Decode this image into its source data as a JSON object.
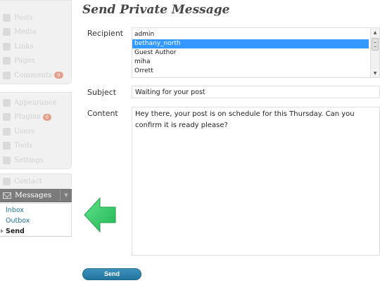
{
  "sidebar": {
    "block1": [
      {
        "label": "Posts",
        "icon": "pin-icon"
      },
      {
        "label": "Media",
        "icon": "media-icon"
      },
      {
        "label": "Links",
        "icon": "links-icon"
      },
      {
        "label": "Pages",
        "icon": "pages-icon"
      },
      {
        "label": "Comments",
        "icon": "comments-icon",
        "badge": "0"
      }
    ],
    "block2": [
      {
        "label": "Appearance",
        "icon": "appearance-icon"
      },
      {
        "label": "Plugins",
        "icon": "plugins-icon",
        "badge": "0"
      },
      {
        "label": "Users",
        "icon": "users-icon"
      },
      {
        "label": "Tools",
        "icon": "tools-icon"
      },
      {
        "label": "Settings",
        "icon": "settings-icon"
      }
    ],
    "block3": [
      {
        "label": "Contact",
        "icon": "contact-icon"
      }
    ],
    "messages": {
      "title": "Messages",
      "icon": "mail-icon",
      "submenu": [
        "Inbox",
        "Outbox",
        "Send"
      ],
      "current": "Send"
    }
  },
  "page": {
    "title": "Send Private Message"
  },
  "form": {
    "recipient_label": "Recipient",
    "recipients": [
      "admin",
      "bethany_north",
      "Guest Author",
      "miha",
      "Orrett"
    ],
    "selected_recipient": "bethany_north",
    "subject_label": "Subject",
    "subject_value": "Waiting for your post",
    "content_label": "Content",
    "content_value": "Hey there, your post is on schedule for this Thursday. Can you confirm it is ready please?",
    "send_label": "Send"
  },
  "colors": {
    "accent": "#21759b",
    "arrow": "#3ecf6e",
    "selection": "#3399ff",
    "badge": "#d54e21"
  }
}
